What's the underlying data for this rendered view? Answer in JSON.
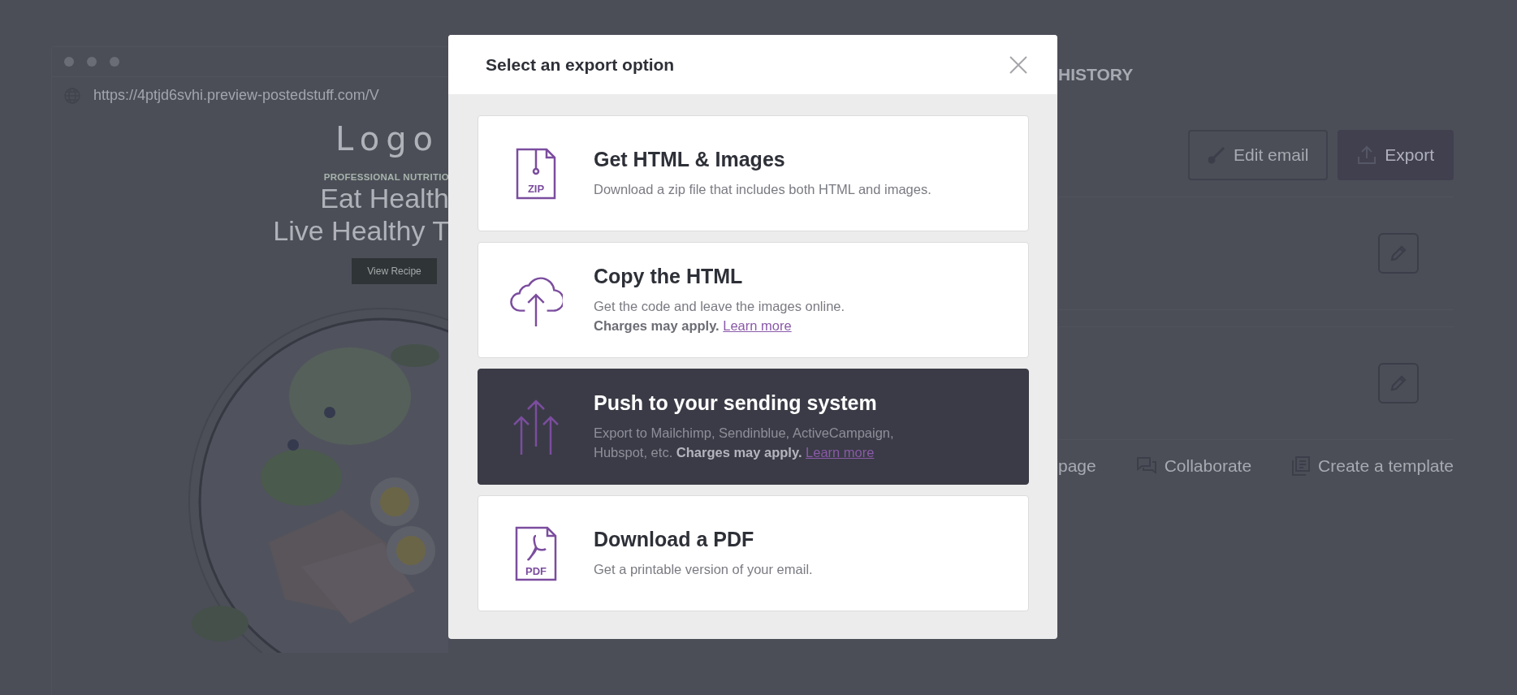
{
  "browser": {
    "url": "https://4ptjd6svhi.preview-postedstuff.com/V"
  },
  "email_preview": {
    "logo": "Logo",
    "eyebrow": "PROFESSIONAL NUTRITIO",
    "headline_lines": [
      "Eat Health",
      "Live Healthy T"
    ],
    "button": "View Recipe",
    "image": {
      "kind": "picture"
    }
  },
  "sidebar": {
    "heading": "HISTORY",
    "buttons": [
      {
        "label": "Edit email",
        "kind": "outline"
      },
      {
        "label": "Export",
        "kind": "primary"
      }
    ],
    "actions": [
      {
        "label": "page",
        "kind": "plain"
      },
      {
        "label": "Collaborate",
        "kind": "collaborate"
      },
      {
        "label": "Create a template",
        "kind": "template"
      }
    ]
  },
  "modal": {
    "title": "Select an export option",
    "options": [
      {
        "kind": "zip",
        "icon_label": "ZIP",
        "title": "Get HTML & Images",
        "description_lines": [
          "Download a zip file that includes both HTML and images."
        ],
        "selected": false
      },
      {
        "kind": "cloud",
        "title": "Copy the HTML",
        "description_lines": [
          "Get the code and leave the images online.",
          "**Charges may apply.**"
        ],
        "link": "Learn more",
        "selected": false
      },
      {
        "kind": "push",
        "title": "Push to your sending system",
        "description_lines": [
          "Export to Mailchimp, Sendinblue, ActiveCampaign,",
          "Hubspot, etc. **Charges may apply.**"
        ],
        "link": "Learn more",
        "selected": true
      },
      {
        "kind": "pdf",
        "icon_label": "PDF",
        "title": "Download a PDF",
        "description_lines": [
          "Get a printable version of your email."
        ],
        "selected": false
      }
    ]
  }
}
